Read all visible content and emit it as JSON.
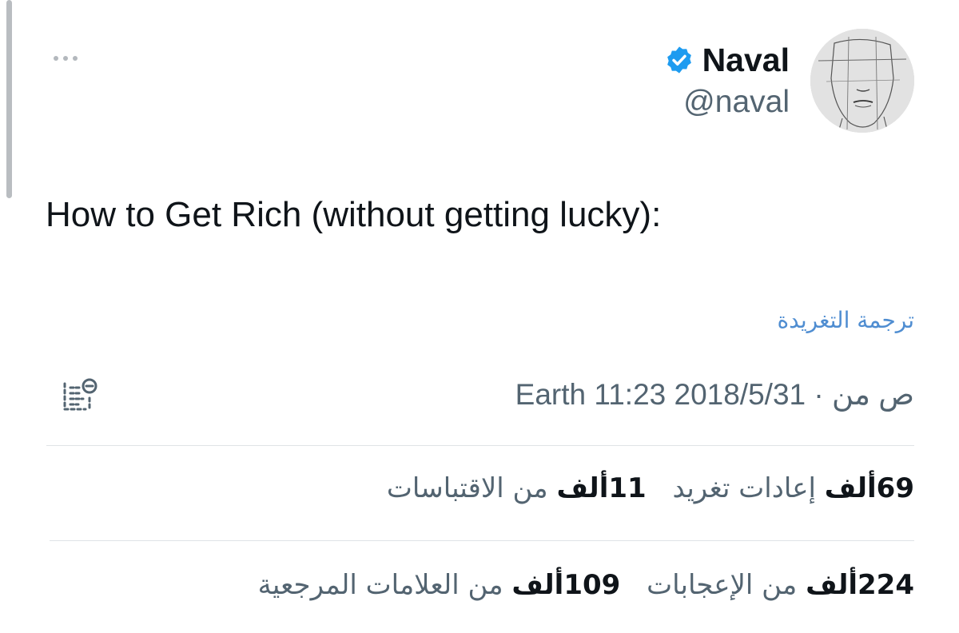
{
  "author": {
    "display_name": "Naval",
    "handle": "@naval",
    "verified": true
  },
  "tweet": {
    "text": "How to Get Rich (without getting lucky):",
    "translate_label": "ترجمة التغريدة",
    "date": "2018/5/31",
    "separator": "·",
    "time": "11:23 ص من",
    "location": "Earth"
  },
  "stats": {
    "retweets": {
      "value": "69ألف",
      "label": "إعادات تغريد"
    },
    "quotes": {
      "value": "11ألف",
      "label": "من الاقتباسات"
    },
    "likes": {
      "value": "224ألف",
      "label": "من الإعجابات"
    },
    "bookmarks": {
      "value": "109ألف",
      "label": "من العلامات المرجعية"
    }
  },
  "icons": {
    "more": "more-horizontal-icon",
    "verified": "verified-badge-icon",
    "notes": "community-notes-icon"
  },
  "colors": {
    "text_primary": "#0f1419",
    "text_secondary": "#536471",
    "link": "#4f8dd1",
    "verified": "#1d9bf0",
    "divider": "#dfe3e6"
  }
}
